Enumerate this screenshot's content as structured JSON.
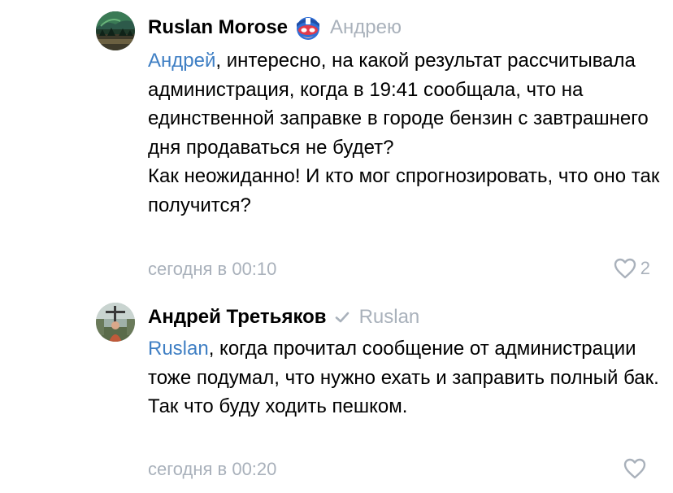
{
  "comments": [
    {
      "author": "Ruslan Morose",
      "reply_to": "Андрею",
      "mention": "Андрей",
      "text_rest": ", интересно, на какой результат рассчитывала администрация, когда в 19:41 сообщала, что на единственной заправке в городе бензин с завтрашнего дня продаваться не будет?",
      "text_line2": "Как неожиданно! И кто мог спрогнозировать, что оно так получится?",
      "time": "сегодня в 00:10",
      "likes": "2",
      "badge_icon": "superhero-mask-emoji-icon",
      "avatar_icon": "landscape-avatar"
    },
    {
      "author": "Андрей Третьяков",
      "reply_to": "Ruslan",
      "mention": "Ruslan",
      "text_rest": ", когда прочитал сообщение от администрации тоже подумал, что нужно ехать и заправить полный бак. Так что буду ходить пешком.",
      "time": "сегодня в 00:20",
      "likes": "",
      "badge_icon": "verified-check-icon",
      "avatar_icon": "person-avatar"
    }
  ],
  "colors": {
    "mention": "#3f7fc4",
    "muted": "#a9b1bb",
    "text": "#000000"
  }
}
